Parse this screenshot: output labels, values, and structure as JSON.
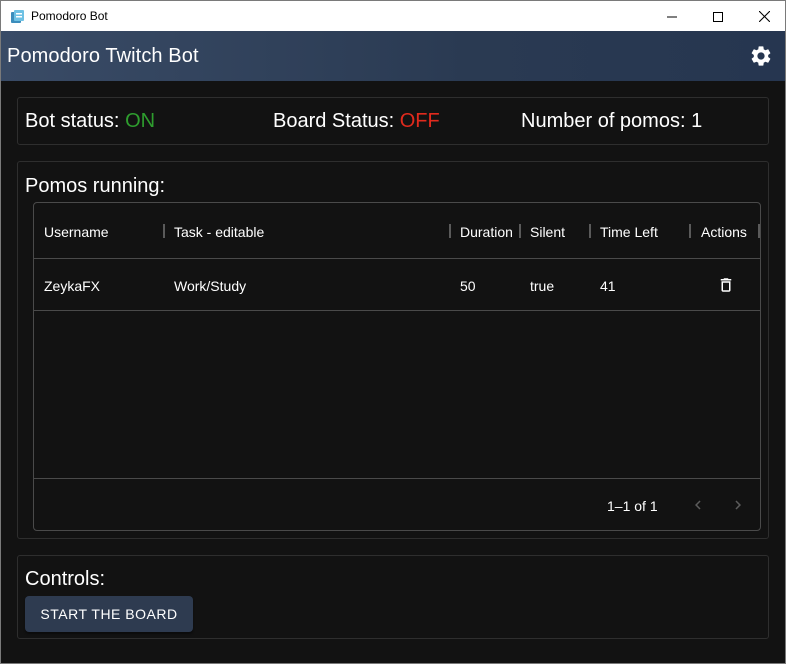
{
  "window": {
    "title": "Pomodoro Bot",
    "controls": {
      "minimize": "minimize-icon",
      "maximize": "maximize-icon",
      "close": "close-icon"
    }
  },
  "appbar": {
    "title": "Pomodoro Twitch Bot",
    "settings_icon": "gear-icon"
  },
  "status": {
    "bot_label": "Bot status: ",
    "bot_value": "ON",
    "board_label": "Board Status: ",
    "board_value": "OFF",
    "count_label": "Number of pomos: ",
    "count_value": "1"
  },
  "pomos": {
    "title": "Pomos running:",
    "columns": [
      "Username",
      "Task - editable",
      "Duration",
      "Silent",
      "Time Left",
      "Actions"
    ],
    "rows": [
      {
        "username": "ZeykaFX",
        "task": "Work/Study",
        "duration": "50",
        "silent": "true",
        "time_left": "41",
        "action_icon": "trash-icon"
      }
    ],
    "pagination": {
      "label": "1–1 of 1"
    }
  },
  "controls": {
    "title": "Controls:",
    "start_button": "START THE BOARD"
  },
  "colors": {
    "on": "#2e9d2e",
    "off": "#e02a1d",
    "appbar": "#2a3a52",
    "background": "#121212",
    "button": "#2e3b50"
  }
}
